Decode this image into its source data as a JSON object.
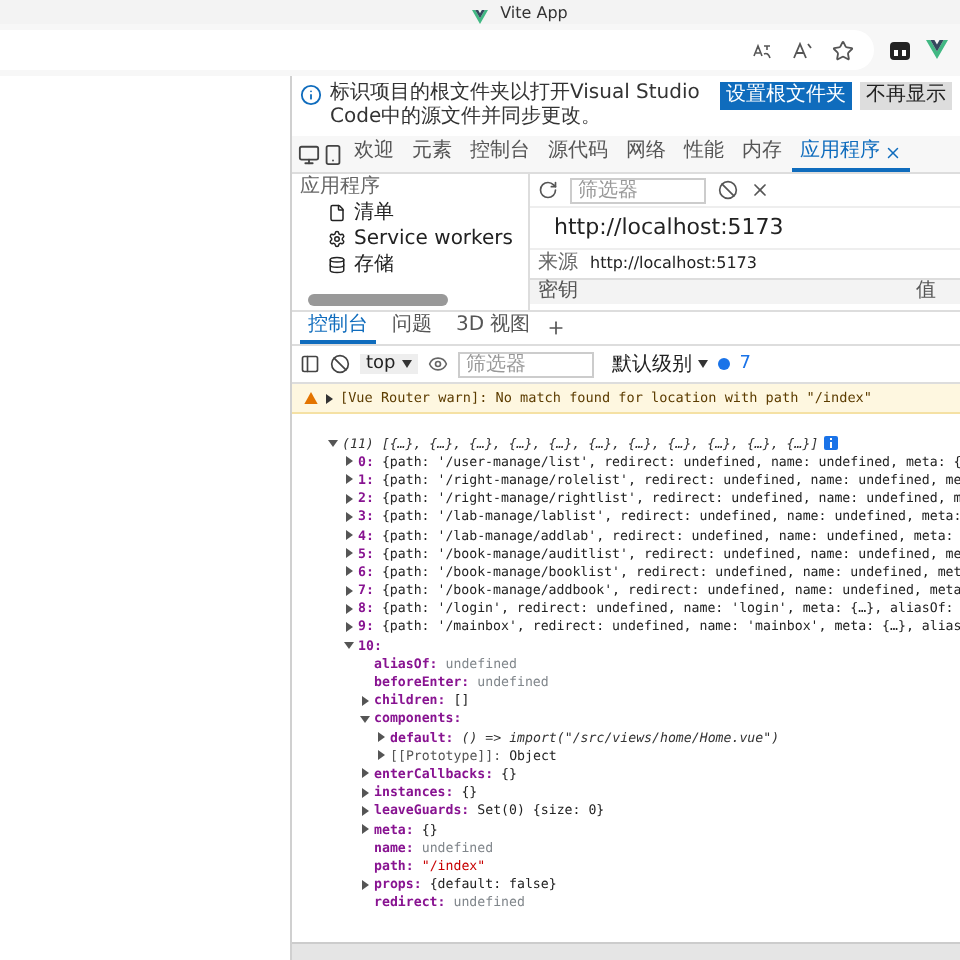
{
  "browser": {
    "tab_title": "Vite App"
  },
  "infobar": {
    "text": "标识项目的根文件夹以打开Visual Studio Code中的源文件并同步更改。",
    "buttons": [
      {
        "label": "设置根文件夹",
        "kind": "primary"
      },
      {
        "label": "不再显示",
        "kind": "secondary"
      }
    ]
  },
  "devtools_tabs": [
    {
      "label": "欢迎",
      "selected": false
    },
    {
      "label": "元素",
      "selected": false
    },
    {
      "label": "控制台",
      "selected": false
    },
    {
      "label": "源代码",
      "selected": false
    },
    {
      "label": "网络",
      "selected": false
    },
    {
      "label": "性能",
      "selected": false
    },
    {
      "label": "内存",
      "selected": false
    },
    {
      "label": "应用程序",
      "selected": true
    }
  ],
  "application": {
    "sidebar_title": "应用程序",
    "items": [
      {
        "label": "清单",
        "kind": "file"
      },
      {
        "label": "Service workers",
        "kind": "gear"
      },
      {
        "label": "存储",
        "kind": "database"
      }
    ],
    "filter_placeholder": "筛选器",
    "url": "http://localhost:5173",
    "origin_label": "来源",
    "origin": "http://localhost:5173",
    "columns": [
      "密钥",
      "值"
    ]
  },
  "drawer_tabs": [
    {
      "label": "控制台",
      "selected": true
    },
    {
      "label": "问题",
      "selected": false
    },
    {
      "label": "3D 视图",
      "selected": false
    }
  ],
  "console_toolbar": {
    "context": "top",
    "filter_placeholder": "筛选器",
    "level": "默认级别",
    "issues": "7"
  },
  "warning": "[Vue Router warn]: No match found for location with path \"/index\"",
  "tree": {
    "summary": "(11) [{…}, {…}, {…}, {…}, {…}, {…}, {…}, {…}, {…}, {…}, {…}]",
    "expanded": true,
    "children": [
      {
        "key": "0:",
        "value": "{path: '/user-manage/list', redirect: undefined, name: undefined, meta: {",
        "kind": "object",
        "expanded": false
      },
      {
        "key": "1:",
        "value": "{path: '/right-manage/rolelist', redirect: undefined, name: undefined, me",
        "kind": "object",
        "expanded": false
      },
      {
        "key": "2:",
        "value": "{path: '/right-manage/rightlist', redirect: undefined, name: undefined, m",
        "kind": "object",
        "expanded": false
      },
      {
        "key": "3:",
        "value": "{path: '/lab-manage/lablist', redirect: undefined, name: undefined, meta:",
        "kind": "object",
        "expanded": false
      },
      {
        "key": "4:",
        "value": "{path: '/lab-manage/addlab', redirect: undefined, name: undefined, meta:",
        "kind": "object",
        "expanded": false
      },
      {
        "key": "5:",
        "value": "{path: '/book-manage/auditlist', redirect: undefined, name: undefined, me",
        "kind": "object",
        "expanded": false
      },
      {
        "key": "6:",
        "value": "{path: '/book-manage/booklist', redirect: undefined, name: undefined, met",
        "kind": "object",
        "expanded": false
      },
      {
        "key": "7:",
        "value": "{path: '/book-manage/addbook', redirect: undefined, name: undefined, meta",
        "kind": "object",
        "expanded": false
      },
      {
        "key": "8:",
        "value": "{path: '/login', redirect: undefined, name: 'login', meta: {…}, aliasOf:",
        "kind": "object",
        "expanded": false
      },
      {
        "key": "9:",
        "value": "{path: '/mainbox', redirect: undefined, name: 'mainbox', meta: {…}, alias",
        "kind": "object",
        "expanded": false
      },
      {
        "key": "10:",
        "expanded": true,
        "children": [
          {
            "key": "aliasOf:",
            "value": "undefined",
            "kind": "undefined"
          },
          {
            "key": "beforeEnter:",
            "value": "undefined",
            "kind": "undefined"
          },
          {
            "key": "children:",
            "value": "[]",
            "kind": "object",
            "expanded": false
          },
          {
            "key": "components:",
            "expanded": true,
            "children": [
              {
                "key": "default:",
                "value": "() => import(\"/src/views/home/Home.vue\")",
                "kind": "function",
                "expanded": false
              },
              {
                "key": "[[Prototype]]:",
                "value": "Object",
                "kind": "internal",
                "expanded": false
              }
            ]
          },
          {
            "key": "enterCallbacks:",
            "value": "{}",
            "kind": "object",
            "expanded": false
          },
          {
            "key": "instances:",
            "value": "{}",
            "kind": "object",
            "expanded": false
          },
          {
            "key": "leaveGuards:",
            "value": "Set(0) {size: 0}",
            "kind": "object",
            "expanded": false
          },
          {
            "key": "meta:",
            "value": "{}",
            "kind": "object",
            "expanded": false
          },
          {
            "key": "name:",
            "value": "undefined",
            "kind": "undefined"
          },
          {
            "key": "path:",
            "value": "\"/index\"",
            "kind": "string"
          },
          {
            "key": "props:",
            "value": "{default: false}",
            "kind": "object",
            "expanded": false
          },
          {
            "key": "redirect:",
            "value": "undefined",
            "kind": "undefined"
          }
        ]
      }
    ]
  }
}
